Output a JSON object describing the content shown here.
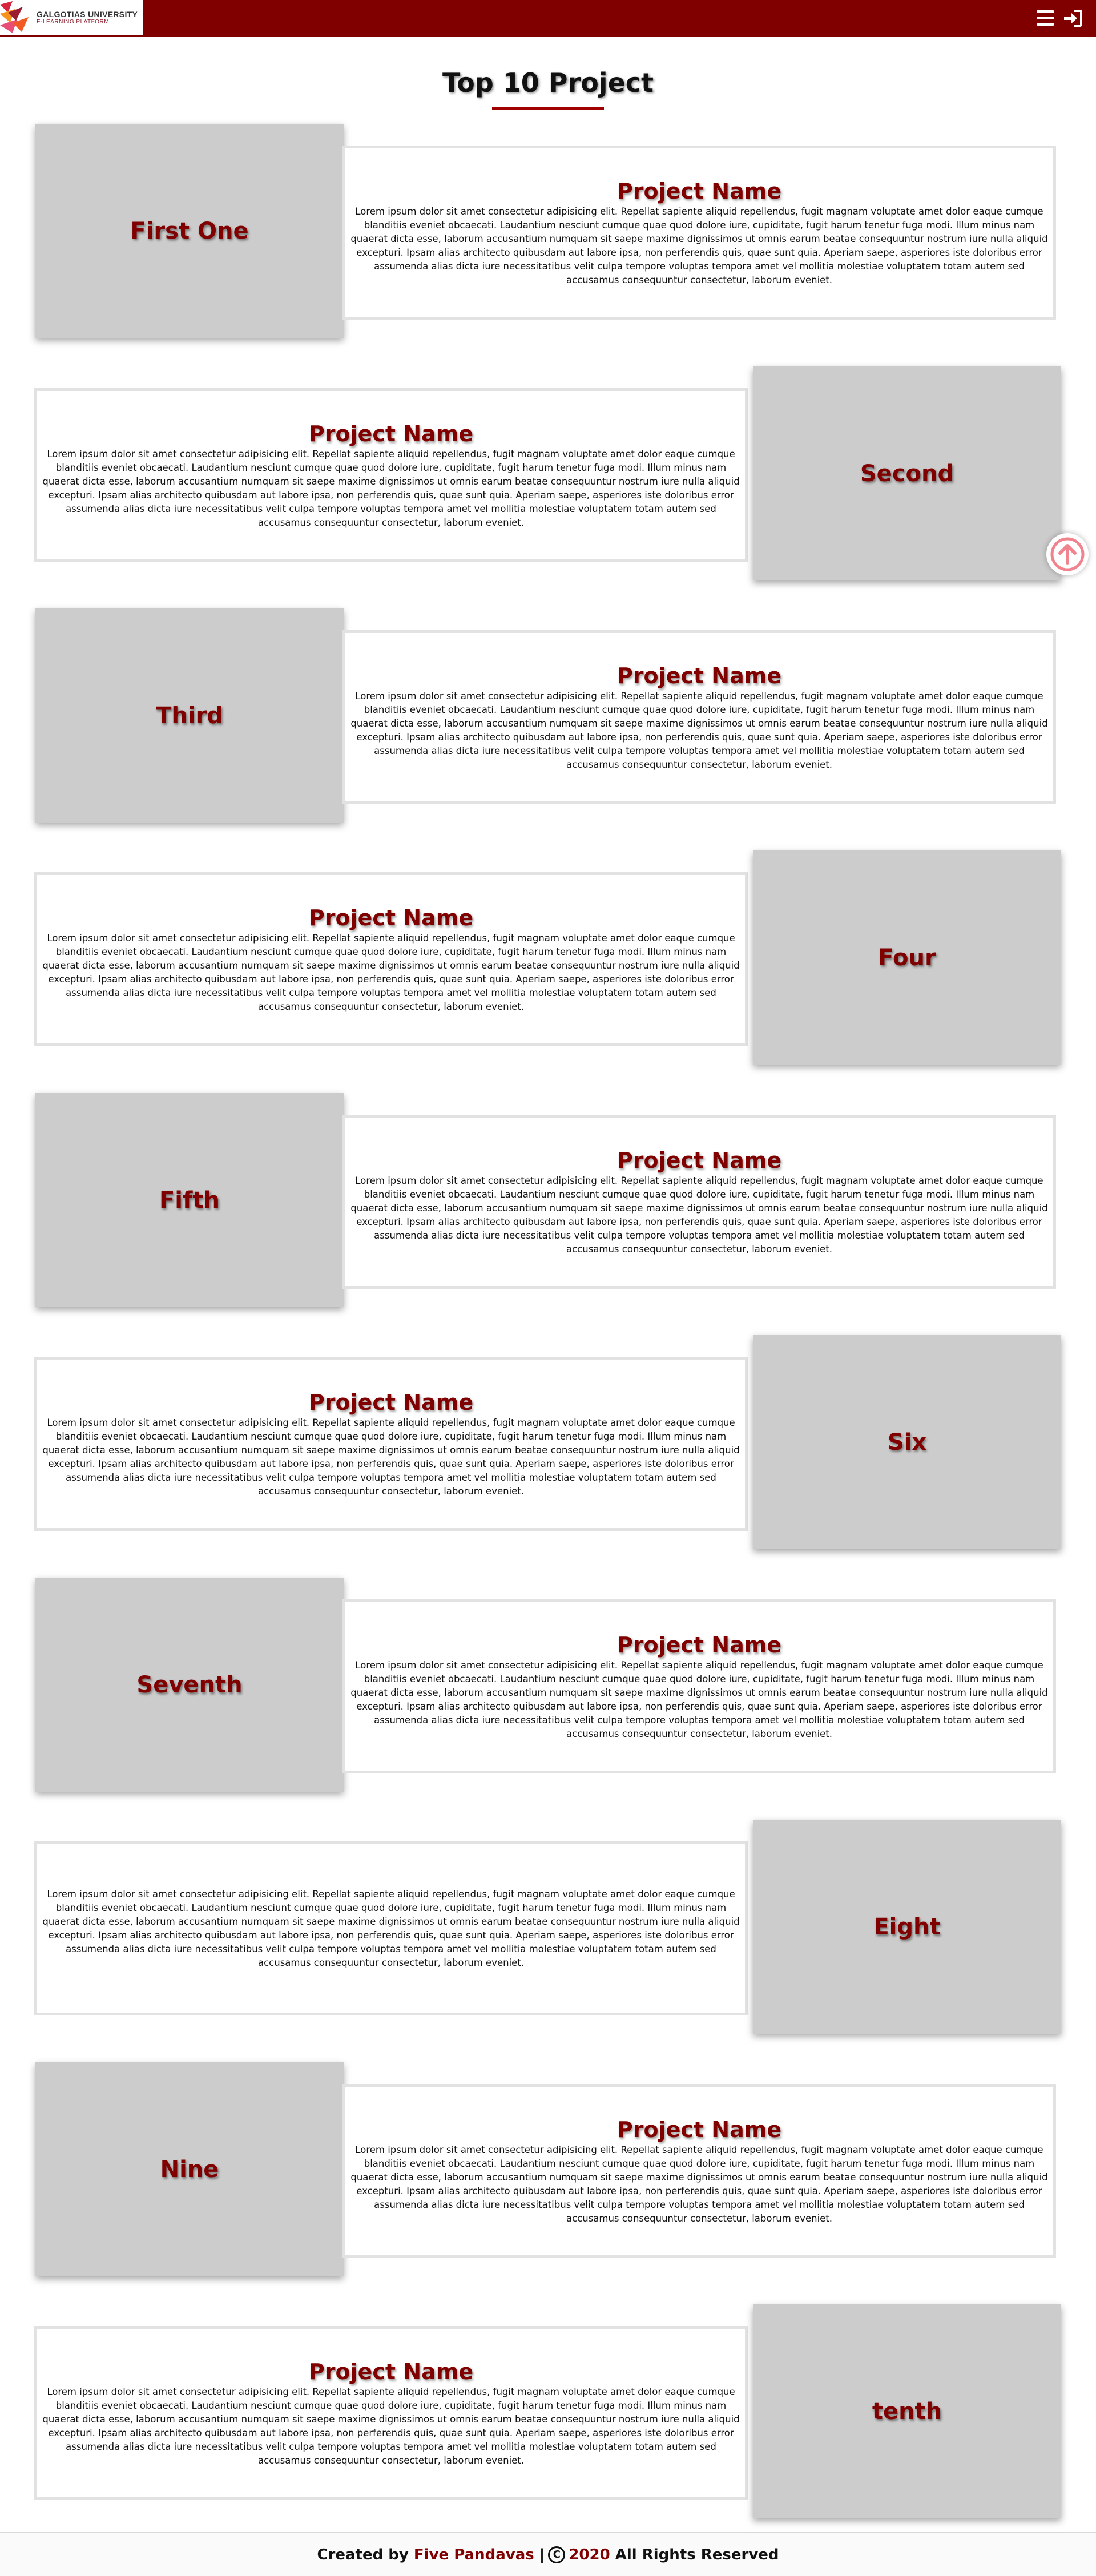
{
  "header": {
    "logo": {
      "name": "GALGOTIAS UNIVERSITY",
      "tagline": "E-LEARNING PLATFORM"
    },
    "menu_icon": "hamburger-icon",
    "login_icon": "sign-in-icon",
    "background_color": "#800000"
  },
  "main": {
    "title": "Top 10 Project",
    "projects": [
      {
        "label": "First One",
        "name": "Project Name",
        "description": "Lorem ipsum dolor sit amet consectetur adipisicing elit. Repellat sapiente aliquid repellendus, fugit magnam voluptate amet dolor eaque cumque blanditiis eveniet obcaecati. Laudantium nesciunt cumque quae quod dolore iure, cupiditate, fugit harum tenetur fuga modi. Illum minus nam quaerat dicta esse, laborum accusantium numquam sit saepe maxime dignissimos ut omnis earum beatae consequuntur nostrum iure nulla aliquid excepturi. Ipsam alias architecto quibusdam aut labore ipsa, non perferendis quis, quae sunt quia. Aperiam saepe, asperiores iste doloribus error assumenda alias dicta iure necessitatibus velit culpa tempore voluptas tempora amet vel mollitia molestiae voluptatem totam autem sed accusamus consequuntur consectetur, laborum eveniet."
      },
      {
        "label": "Second",
        "name": "Project Name",
        "description": "Lorem ipsum dolor sit amet consectetur adipisicing elit. Repellat sapiente aliquid repellendus, fugit magnam voluptate amet dolor eaque cumque blanditiis eveniet obcaecati. Laudantium nesciunt cumque quae quod dolore iure, cupiditate, fugit harum tenetur fuga modi. Illum minus nam quaerat dicta esse, laborum accusantium numquam sit saepe maxime dignissimos ut omnis earum beatae consequuntur nostrum iure nulla aliquid excepturi. Ipsam alias architecto quibusdam aut labore ipsa, non perferendis quis, quae sunt quia. Aperiam saepe, asperiores iste doloribus error assumenda alias dicta iure necessitatibus velit culpa tempore voluptas tempora amet vel mollitia molestiae voluptatem totam autem sed accusamus consequuntur consectetur, laborum eveniet."
      },
      {
        "label": "Third",
        "name": "Project Name",
        "description": "Lorem ipsum dolor sit amet consectetur adipisicing elit. Repellat sapiente aliquid repellendus, fugit magnam voluptate amet dolor eaque cumque blanditiis eveniet obcaecati. Laudantium nesciunt cumque quae quod dolore iure, cupiditate, fugit harum tenetur fuga modi. Illum minus nam quaerat dicta esse, laborum accusantium numquam sit saepe maxime dignissimos ut omnis earum beatae consequuntur nostrum iure nulla aliquid excepturi. Ipsam alias architecto quibusdam aut labore ipsa, non perferendis quis, quae sunt quia. Aperiam saepe, asperiores iste doloribus error assumenda alias dicta iure necessitatibus velit culpa tempore voluptas tempora amet vel mollitia molestiae voluptatem totam autem sed accusamus consequuntur consectetur, laborum eveniet."
      },
      {
        "label": "Four",
        "name": "Project Name",
        "description": "Lorem ipsum dolor sit amet consectetur adipisicing elit. Repellat sapiente aliquid repellendus, fugit magnam voluptate amet dolor eaque cumque blanditiis eveniet obcaecati. Laudantium nesciunt cumque quae quod dolore iure, cupiditate, fugit harum tenetur fuga modi. Illum minus nam quaerat dicta esse, laborum accusantium numquam sit saepe maxime dignissimos ut omnis earum beatae consequuntur nostrum iure nulla aliquid excepturi. Ipsam alias architecto quibusdam aut labore ipsa, non perferendis quis, quae sunt quia. Aperiam saepe, asperiores iste doloribus error assumenda alias dicta iure necessitatibus velit culpa tempore voluptas tempora amet vel mollitia molestiae voluptatem totam autem sed accusamus consequuntur consectetur, laborum eveniet."
      },
      {
        "label": "Fifth",
        "name": "Project Name",
        "description": "Lorem ipsum dolor sit amet consectetur adipisicing elit. Repellat sapiente aliquid repellendus, fugit magnam voluptate amet dolor eaque cumque blanditiis eveniet obcaecati. Laudantium nesciunt cumque quae quod dolore iure, cupiditate, fugit harum tenetur fuga modi. Illum minus nam quaerat dicta esse, laborum accusantium numquam sit saepe maxime dignissimos ut omnis earum beatae consequuntur nostrum iure nulla aliquid excepturi. Ipsam alias architecto quibusdam aut labore ipsa, non perferendis quis, quae sunt quia. Aperiam saepe, asperiores iste doloribus error assumenda alias dicta iure necessitatibus velit culpa tempore voluptas tempora amet vel mollitia molestiae voluptatem totam autem sed accusamus consequuntur consectetur, laborum eveniet."
      },
      {
        "label": "Six",
        "name": "Project Name",
        "description": "Lorem ipsum dolor sit amet consectetur adipisicing elit. Repellat sapiente aliquid repellendus, fugit magnam voluptate amet dolor eaque cumque blanditiis eveniet obcaecati. Laudantium nesciunt cumque quae quod dolore iure, cupiditate, fugit harum tenetur fuga modi. Illum minus nam quaerat dicta esse, laborum accusantium numquam sit saepe maxime dignissimos ut omnis earum beatae consequuntur nostrum iure nulla aliquid excepturi. Ipsam alias architecto quibusdam aut labore ipsa, non perferendis quis, quae sunt quia. Aperiam saepe, asperiores iste doloribus error assumenda alias dicta iure necessitatibus velit culpa tempore voluptas tempora amet vel mollitia molestiae voluptatem totam autem sed accusamus consequuntur consectetur, laborum eveniet."
      },
      {
        "label": "Seventh",
        "name": "Project Name",
        "description": "Lorem ipsum dolor sit amet consectetur adipisicing elit. Repellat sapiente aliquid repellendus, fugit magnam voluptate amet dolor eaque cumque blanditiis eveniet obcaecati. Laudantium nesciunt cumque quae quod dolore iure, cupiditate, fugit harum tenetur fuga modi. Illum minus nam quaerat dicta esse, laborum accusantium numquam sit saepe maxime dignissimos ut omnis earum beatae consequuntur nostrum iure nulla aliquid excepturi. Ipsam alias architecto quibusdam aut labore ipsa, non perferendis quis, quae sunt quia. Aperiam saepe, asperiores iste doloribus error assumenda alias dicta iure necessitatibus velit culpa tempore voluptas tempora amet vel mollitia molestiae voluptatem totam autem sed accusamus consequuntur consectetur, laborum eveniet."
      },
      {
        "label": "Eight",
        "name": "",
        "description": "Lorem ipsum dolor sit amet consectetur adipisicing elit. Repellat sapiente aliquid repellendus, fugit magnam voluptate amet dolor eaque cumque blanditiis eveniet obcaecati. Laudantium nesciunt cumque quae quod dolore iure, cupiditate, fugit harum tenetur fuga modi. Illum minus nam quaerat dicta esse, laborum accusantium numquam sit saepe maxime dignissimos ut omnis earum beatae consequuntur nostrum iure nulla aliquid excepturi. Ipsam alias architecto quibusdam aut labore ipsa, non perferendis quis, quae sunt quia. Aperiam saepe, asperiores iste doloribus error assumenda alias dicta iure necessitatibus velit culpa tempore voluptas tempora amet vel mollitia molestiae voluptatem totam autem sed accusamus consequuntur consectetur, laborum eveniet."
      },
      {
        "label": "Nine",
        "name": "Project Name",
        "description": "Lorem ipsum dolor sit amet consectetur adipisicing elit. Repellat sapiente aliquid repellendus, fugit magnam voluptate amet dolor eaque cumque blanditiis eveniet obcaecati. Laudantium nesciunt cumque quae quod dolore iure, cupiditate, fugit harum tenetur fuga modi. Illum minus nam quaerat dicta esse, laborum accusantium numquam sit saepe maxime dignissimos ut omnis earum beatae consequuntur nostrum iure nulla aliquid excepturi. Ipsam alias architecto quibusdam aut labore ipsa, non perferendis quis, quae sunt quia. Aperiam saepe, asperiores iste doloribus error assumenda alias dicta iure necessitatibus velit culpa tempore voluptas tempora amet vel mollitia molestiae voluptatem totam autem sed accusamus consequuntur consectetur, laborum eveniet."
      },
      {
        "label": "tenth",
        "name": "Project Name",
        "description": "Lorem ipsum dolor sit amet consectetur adipisicing elit. Repellat sapiente aliquid repellendus, fugit magnam voluptate amet dolor eaque cumque blanditiis eveniet obcaecati. Laudantium nesciunt cumque quae quod dolore iure, cupiditate, fugit harum tenetur fuga modi. Illum minus nam quaerat dicta esse, laborum accusantium numquam sit saepe maxime dignissimos ut omnis earum beatae consequuntur nostrum iure nulla aliquid excepturi. Ipsam alias architecto quibusdam aut labore ipsa, non perferendis quis, quae sunt quia. Aperiam saepe, asperiores iste doloribus error assumenda alias dicta iure necessitatibus velit culpa tempore voluptas tempora amet vel mollitia molestiae voluptatem totam autem sed accusamus consequuntur consectetur, laborum eveniet."
      }
    ]
  },
  "scroll_top": {
    "icon": "arrow-up-circle-icon"
  },
  "footer": {
    "prefix": "Created by",
    "team": "Five Pandavas",
    "separator": "|",
    "copyright_symbol": "C",
    "year": "2020",
    "suffix": "All Rights Reserved"
  },
  "colors": {
    "brand": "#800000",
    "image_placeholder": "#cccccc",
    "text_box_border": "#e2e2e2"
  }
}
